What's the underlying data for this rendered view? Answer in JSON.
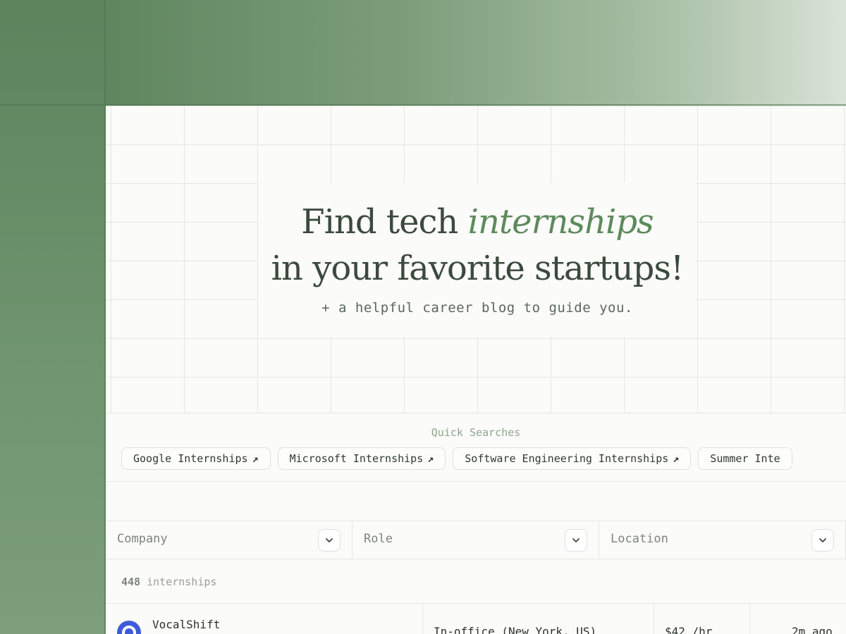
{
  "hero": {
    "headline_part1": "Find tech ",
    "headline_accent": "internships",
    "headline_line2": "in your favorite startups!",
    "subline": "+ a helpful career blog to guide you."
  },
  "quick_searches": {
    "title": "Quick Searches",
    "chips": [
      {
        "label": "Google Internships",
        "icon": "arrow-up-right-icon"
      },
      {
        "label": "Microsoft Internships",
        "icon": "arrow-up-right-icon"
      },
      {
        "label": "Software Engineering Internships",
        "icon": "arrow-up-right-icon"
      },
      {
        "label": "Summer Inte"
      }
    ]
  },
  "filters": [
    {
      "label": "Company",
      "icon": "chevron-down-icon"
    },
    {
      "label": "Role",
      "icon": "chevron-down-icon"
    },
    {
      "label": "Location",
      "icon": "chevron-down-icon"
    }
  ],
  "results": {
    "count": "448",
    "count_suffix": " internships"
  },
  "listings": [
    {
      "company": "VocalShift",
      "location": "In-office (New York, US)",
      "pay": "$42 /hr",
      "posted": "2m ago"
    }
  ],
  "colors": {
    "accent": "#5d8a5d",
    "logo_blue": "#3f5bd9",
    "background": "#fbfbf9"
  }
}
